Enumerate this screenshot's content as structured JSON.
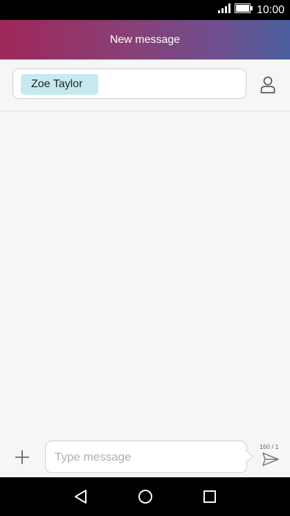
{
  "status_bar": {
    "time": "10:00",
    "signal_icon": "signal-bars-icon",
    "battery_icon": "battery-icon"
  },
  "header": {
    "title": "New message"
  },
  "recipient": {
    "chip_label": "Zoe Taylor",
    "contact_icon": "person-icon"
  },
  "composer": {
    "placeholder": "Type message",
    "counter": "160 / 1",
    "add_icon": "plus-icon",
    "send_icon": "send-icon"
  },
  "nav": {
    "back_icon": "back-triangle-icon",
    "home_icon": "home-circle-icon",
    "recents_icon": "recents-square-icon"
  },
  "colors": {
    "chip_bg": "#c5eaf0",
    "header_start": "#a0275a",
    "header_end": "#4d5f9f"
  }
}
